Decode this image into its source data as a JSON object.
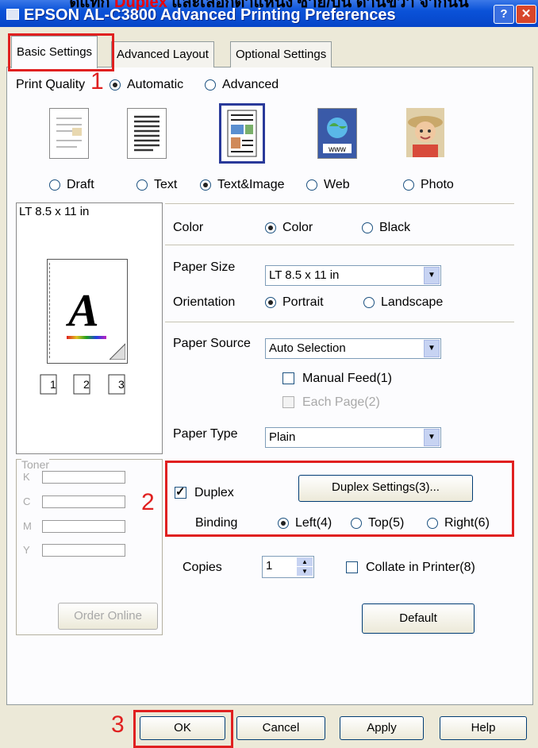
{
  "overlay_caption": {
    "prefix": "ิดแท็ก",
    "highlight": "Duplex",
    "suffix": "และเลือกตำแหน่ง ซ้าย/บน ด้านขวา จากนั้น"
  },
  "window": {
    "title": "EPSON AL-C3800 Advanced Printing Preferences",
    "help": "?",
    "close": "✕"
  },
  "tabs": [
    {
      "label": "Basic Settings",
      "active": true
    },
    {
      "label": "Advanced Layout",
      "active": false
    },
    {
      "label": "Optional Settings",
      "active": false
    }
  ],
  "print_quality": {
    "label": "Print Quality",
    "options": [
      {
        "label": "Automatic",
        "selected": true
      },
      {
        "label": "Advanced",
        "selected": false
      }
    ],
    "modes": [
      {
        "label": "Draft",
        "icon": "draft-page-icon",
        "selected": false
      },
      {
        "label": "Text",
        "icon": "text-page-icon",
        "selected": false
      },
      {
        "label": "Text&Image",
        "icon": "text-image-page-icon",
        "selected": true
      },
      {
        "label": "Web",
        "icon": "web-page-icon",
        "selected": false
      },
      {
        "label": "Photo",
        "icon": "photo-icon",
        "selected": false
      }
    ]
  },
  "preview": {
    "paper_label": "LT 8.5 x 11 in",
    "letter": "A",
    "copy_numbers": [
      "1",
      "2",
      "3"
    ]
  },
  "color": {
    "label": "Color",
    "options": [
      {
        "label": "Color",
        "selected": true
      },
      {
        "label": "Black",
        "selected": false
      }
    ]
  },
  "paper_size": {
    "label": "Paper Size",
    "value": "LT 8.5 x 11 in"
  },
  "orientation": {
    "label": "Orientation",
    "options": [
      {
        "label": "Portrait",
        "selected": true
      },
      {
        "label": "Landscape",
        "selected": false
      }
    ]
  },
  "paper_source": {
    "label": "Paper Source",
    "value": "Auto Selection",
    "manual_feed": "Manual Feed(1)",
    "each_page": "Each Page(2)"
  },
  "paper_type": {
    "label": "Paper Type",
    "value": "Plain"
  },
  "toner": {
    "label": "Toner",
    "channels": [
      "K",
      "C",
      "M",
      "Y"
    ]
  },
  "order_online": "Order Online",
  "duplex": {
    "label": "Duplex",
    "checked": true,
    "settings_button": "Duplex Settings(3)...",
    "binding_label": "Binding",
    "binding": [
      {
        "label": "Left(4)",
        "selected": true
      },
      {
        "label": "Top(5)",
        "selected": false
      },
      {
        "label": "Right(6)",
        "selected": false
      }
    ]
  },
  "copies": {
    "label": "Copies",
    "value": "1",
    "collate": "Collate in Printer(8)",
    "collate_checked": false
  },
  "default_button": "Default",
  "footer": {
    "ok": "OK",
    "cancel": "Cancel",
    "apply": "Apply",
    "help": "Help"
  },
  "annotations": {
    "step1": "1",
    "step2": "2",
    "step3": "3"
  },
  "colors": {
    "annotation_red": "#e02020",
    "titlebar_blue": "#0a52d8",
    "dialog_bg": "#ece9d8"
  }
}
